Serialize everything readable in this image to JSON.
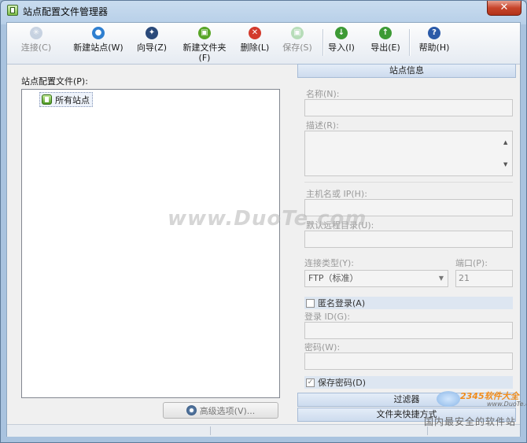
{
  "window": {
    "title": "站点配置文件管理器",
    "close_glyph": "✕"
  },
  "toolbar": [
    {
      "label": "连接(C)",
      "icon": "connect-icon",
      "icon_glyph": "✳",
      "color": "#8fa6c4",
      "enabled": false
    },
    {
      "label": "新建站点(W)",
      "icon": "new-site-icon",
      "icon_glyph": "●",
      "color": "#2f7fd0",
      "enabled": true
    },
    {
      "label": "向导(Z)",
      "icon": "wizard-icon",
      "icon_glyph": "✦",
      "color": "#2b4a7a",
      "enabled": true
    },
    {
      "label": "新建文件夹\n(F)",
      "icon": "new-folder-icon",
      "icon_glyph": "▣",
      "color": "#58a526",
      "enabled": true
    },
    {
      "label": "删除(L)",
      "icon": "delete-icon",
      "icon_glyph": "✕",
      "color": "#d33a2c",
      "enabled": true
    },
    {
      "label": "保存(S)",
      "icon": "save-icon",
      "icon_glyph": "▣",
      "color": "#6bbd6b",
      "enabled": false
    },
    {
      "label": "导入(I)",
      "icon": "import-icon",
      "icon_glyph": "↓",
      "color": "#3d9a35",
      "enabled": true
    },
    {
      "label": "导出(E)",
      "icon": "export-icon",
      "icon_glyph": "↑",
      "color": "#3d9a35",
      "enabled": true
    },
    {
      "label": "帮助(H)",
      "icon": "help-icon",
      "icon_glyph": "?",
      "color": "#2b5aa8",
      "enabled": true
    }
  ],
  "left": {
    "label": "站点配置文件(P):",
    "tree_root": "所有站点",
    "advanced_button": "高级选项(V)..."
  },
  "site_info": {
    "header": "站点信息",
    "name_label": "名称(N):",
    "desc_label": "描述(R):",
    "host_label": "主机名或 IP(H):",
    "remote_dir_label": "默认远程目录(U):",
    "conn_type_label": "连接类型(Y):",
    "conn_type_value": "FTP（标准）",
    "port_label": "端口(P):",
    "port_value": "21",
    "anon_label": "匿名登录(A)",
    "anon_checked": false,
    "login_label": "登录 ID(G):",
    "password_label": "密码(W):",
    "save_pwd_label": "保存密码(D)",
    "save_pwd_checked": true
  },
  "sections": {
    "filter": "过滤器",
    "shortcuts": "文件夹快捷方式"
  },
  "watermark": "www.DuoTe.com",
  "brand": {
    "name": "2345软件大全",
    "url": "www.DuoTe.com",
    "slogan": "国内最安全的软件站"
  }
}
